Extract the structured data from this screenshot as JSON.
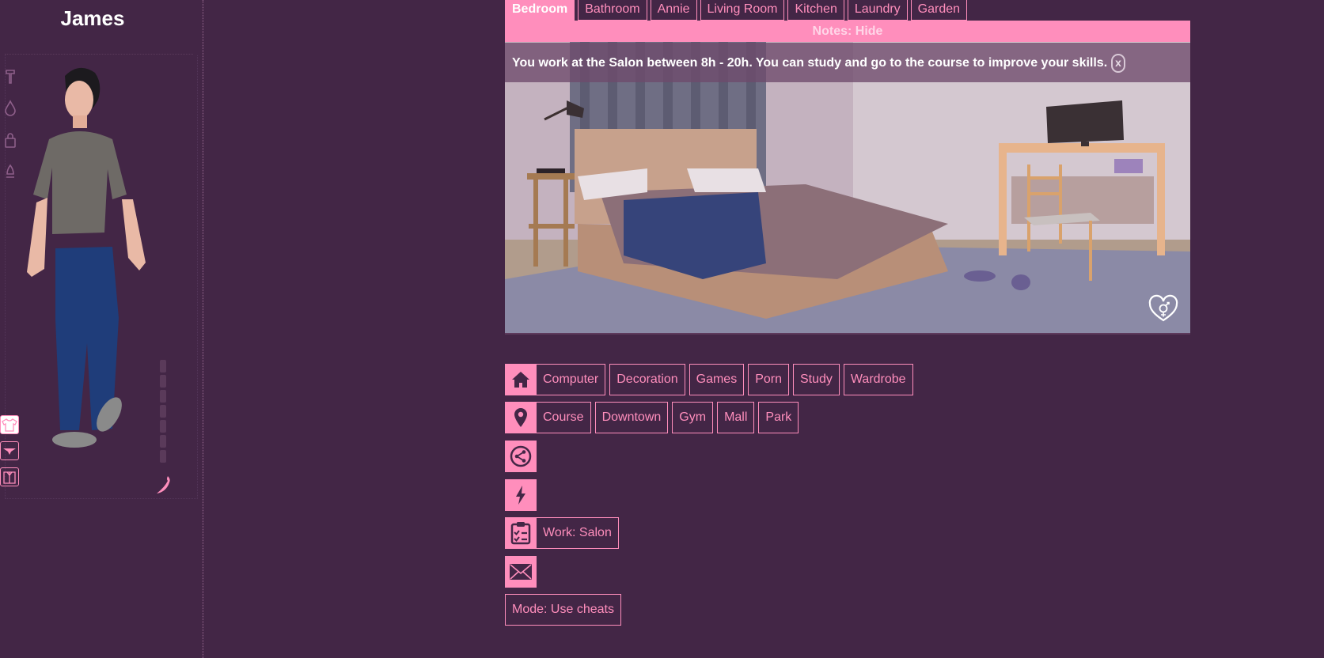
{
  "character": {
    "name": "James"
  },
  "tabs": [
    {
      "label": "Bedroom",
      "active": true
    },
    {
      "label": "Bathroom",
      "active": false
    },
    {
      "label": "Annie",
      "active": false
    },
    {
      "label": "Living Room",
      "active": false
    },
    {
      "label": "Kitchen",
      "active": false
    },
    {
      "label": "Laundry",
      "active": false
    },
    {
      "label": "Garden",
      "active": false
    }
  ],
  "notes": {
    "label": "Notes: Hide"
  },
  "notice": {
    "text": "You work at the Salon between 8h - 20h. You can study and go to the course to improve your skills.",
    "close_label": "x"
  },
  "actions": {
    "home": {
      "icon": "home-icon",
      "items": [
        "Computer",
        "Decoration",
        "Games",
        "Porn",
        "Study",
        "Wardrobe"
      ]
    },
    "location": {
      "icon": "location-pin-icon",
      "items": [
        "Course",
        "Downtown",
        "Gym",
        "Mall",
        "Park"
      ]
    },
    "social": {
      "icon": "share-icon"
    },
    "energy": {
      "icon": "lightning-icon"
    },
    "work": {
      "icon": "clipboard-checklist-icon",
      "label": "Work: Salon"
    },
    "mail": {
      "icon": "envelope-icon"
    },
    "mode": {
      "label": "Mode: Use cheats"
    }
  },
  "colors": {
    "background": "#432646",
    "accent": "#ff8ebc",
    "text": "#ffffff"
  }
}
